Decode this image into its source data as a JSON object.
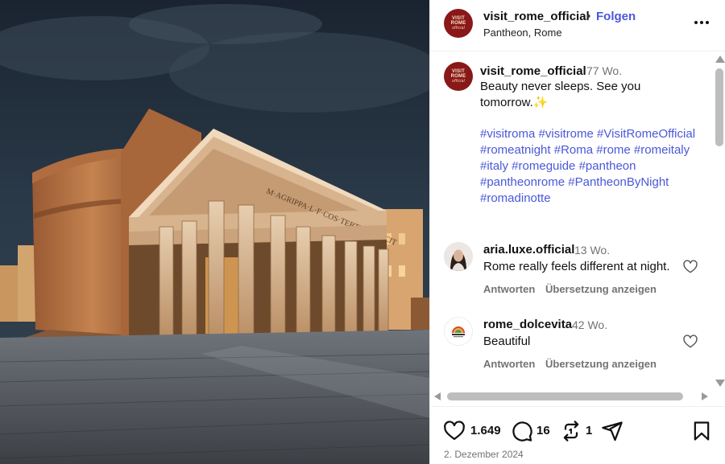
{
  "post": {
    "username": "visit_rome_official",
    "dot": "•",
    "follow_label": "Folgen",
    "location": "Pantheon, Rome",
    "avatar_text": "VISIT ROME",
    "avatar_sub": "official"
  },
  "caption": {
    "username": "visit_rome_official",
    "time": "77 Wo.",
    "text": "Beauty never sleeps. See you tomorrow.✨",
    "hashtags": "#visitroma #visitrome #VisitRomeOfficial #romeatnight #Roma #rome #romeitaly #italy #romeguide #pantheon #pantheonrome #PantheonByNight #romadinotte"
  },
  "comments": [
    {
      "username": "aria.luxe.official",
      "time": "13 Wo.",
      "text": "Rome really feels different at night.",
      "reply_label": "Antworten",
      "translate_label": "Übersetzung anzeigen"
    },
    {
      "username": "rome_dolcevita",
      "time": "42 Wo.",
      "text": "Beautiful",
      "reply_label": "Antworten",
      "translate_label": "Übersetzung anzeigen"
    }
  ],
  "actions": {
    "likes": "1.649",
    "comments": "16",
    "reposts": "1",
    "date": "2. Dezember 2024"
  },
  "photo": {
    "inscription": "M·AGRIPPA·L·F·COS·TERTIVM·FECIT"
  },
  "colors": {
    "link": "#4a58d8",
    "brand": "#8a1818",
    "muted": "#737373"
  },
  "icons": [
    "more-options-icon",
    "heart-icon",
    "comment-icon",
    "repost-icon",
    "share-icon",
    "bookmark-icon",
    "sparkles-icon"
  ]
}
